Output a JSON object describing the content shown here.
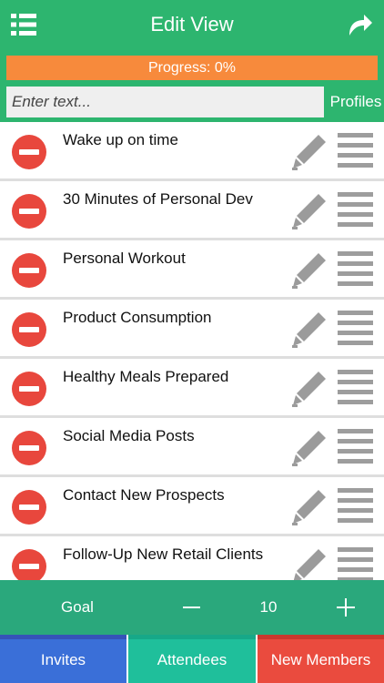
{
  "header": {
    "title": "Edit View",
    "menu_icon": "list-menu-icon",
    "redo_icon": "redo-arrow-icon",
    "background_color": "#2db56f"
  },
  "progress": {
    "label": "Progress: 0%",
    "value": 0,
    "color": "#f78a3c"
  },
  "entry": {
    "placeholder": "Enter text...",
    "value": "",
    "profiles_label": "Profiles"
  },
  "tasks": [
    {
      "label": "Wake up on time"
    },
    {
      "label": "30 Minutes of Personal Dev"
    },
    {
      "label": "Personal Workout"
    },
    {
      "label": "Product Consumption"
    },
    {
      "label": "Healthy Meals Prepared"
    },
    {
      "label": "Social Media Posts"
    },
    {
      "label": "Contact New Prospects"
    },
    {
      "label": "Follow-Up New Retail Clients"
    }
  ],
  "row_icons": {
    "delete": "delete-minus-icon",
    "edit": "pencil-icon",
    "reorder": "drag-handle-icon"
  },
  "goal": {
    "label": "Goal",
    "value": "10",
    "background_color": "#2aa87c"
  },
  "tabs": [
    {
      "label": "Invites",
      "color": "#3a6fd8"
    },
    {
      "label": "Attendees",
      "color": "#1fbf9b"
    },
    {
      "label": "New Members",
      "color": "#ea4b3e"
    }
  ]
}
